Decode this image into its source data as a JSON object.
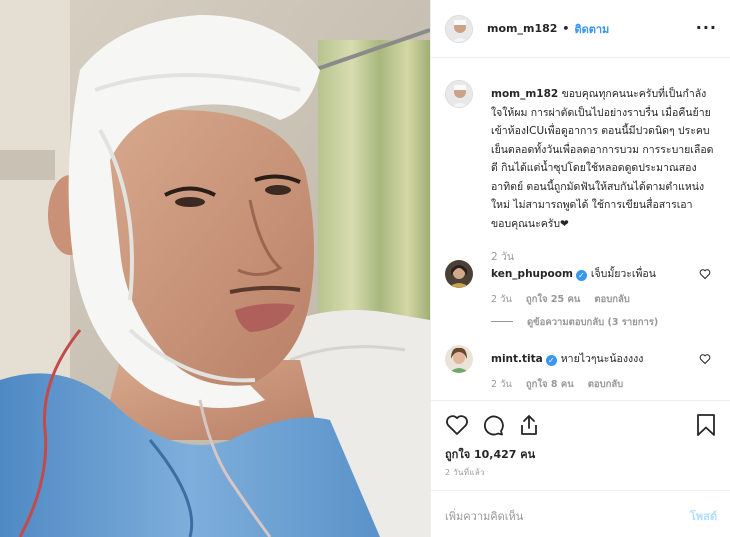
{
  "post": {
    "username": "mom_m182",
    "follow_label": "ติดตาม",
    "more_label": "···",
    "caption_text": "ขอบคุณทุกคนนะครับที่เป็นกำลังใจให้ผม การผ่าตัดเป็นไปอย่างราบรื่น เมื่อคืนย้ายเข้าห้องICUเพื่อดูอาการ ตอนนี้มีปวดนิดๆ ประคบเย็นตลอดทั้งวันเพื่อลดอาการบวม การระบายเลือดดี กินได้แต่น้ำซุปโดยใช้หลอดดูดประมาณสองอาทิตย์ ตอนนี้ถูกมัดฟันให้สบกันได้ตามตำแหน่งใหม่ ไม่สามารถพูดได้ ใช้การเขียนสื่อสารเอา ขอบคุณนะครับ❤",
    "caption_time": "2 วัน"
  },
  "comments": [
    {
      "username": "ken_phupoom",
      "text": "เจ็บมั้ยวะเพื่อน",
      "time": "2 วัน",
      "likes": "ถูกใจ 25 คน",
      "reply_label": "ตอบกลับ",
      "view_replies": "ดูข้อความตอบกลับ (3 รายการ)"
    },
    {
      "username": "mint.tita",
      "text": "หายไวๆนะน้องงงง",
      "time": "2 วัน",
      "likes": "ถูกใจ 8 คน",
      "reply_label": "ตอบกลับ"
    }
  ],
  "actions": {
    "likes_text": "ถูกใจ 10,427 คน",
    "date_text": "2 วันที่แล้ว"
  },
  "add_comment": {
    "placeholder": "เพิ่มความคิดเห็น",
    "post_label": "โพสต์"
  },
  "colors": {
    "link_blue": "#3897f0",
    "muted": "#999999",
    "post_disabled": "#b2dffc"
  }
}
